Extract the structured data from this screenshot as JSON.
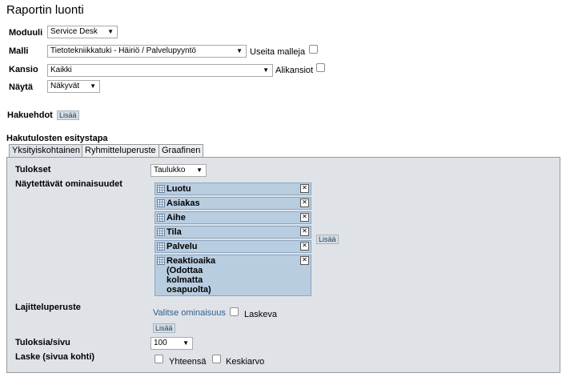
{
  "page": {
    "title": "Raportin luonti"
  },
  "form": {
    "module": {
      "label": "Moduuli",
      "value": "Service Desk"
    },
    "template": {
      "label": "Malli",
      "value": "Tietotekniikkatuki - Häiriö / Palvelupyyntö",
      "multi_label": "Useita malleja"
    },
    "folder": {
      "label": "Kansio",
      "value": "Kaikki",
      "sub_label": "Alikansiot"
    },
    "show": {
      "label": "Näytä",
      "value": "Näkyvät"
    },
    "criteria": {
      "label": "Hakuehdot",
      "add": "Lisää"
    }
  },
  "results": {
    "heading": "Hakutulosten esitystapa",
    "tabs": [
      "Yksityiskohtainen",
      "Ryhmitteluperuste",
      "Graafinen"
    ],
    "output": {
      "label": "Tulokset",
      "value": "Taulukko"
    },
    "attributes": {
      "label": "Näytettävät ominaisuudet",
      "items": [
        "Luotu",
        "Asiakas",
        "Aihe",
        "Tila",
        "Palvelu",
        "Reaktioaika\n(Odottaa\nkolmatta\nosapuolta)"
      ],
      "add": "Lisää"
    },
    "sort": {
      "label": "Lajitteluperuste",
      "choose": "Valitse ominaisuus",
      "desc_label": "Laskeva",
      "add": "Lisää"
    },
    "per_page": {
      "label": "Tuloksia/sivu",
      "value": "100"
    },
    "calc": {
      "label": "Laske (sivua kohti)",
      "sum_label": "Yhteensä",
      "avg_label": "Keskiarvo"
    }
  },
  "icons": {
    "dropdown": "chevron-down-icon",
    "drag": "drag-handle-icon",
    "remove": "close-icon"
  }
}
